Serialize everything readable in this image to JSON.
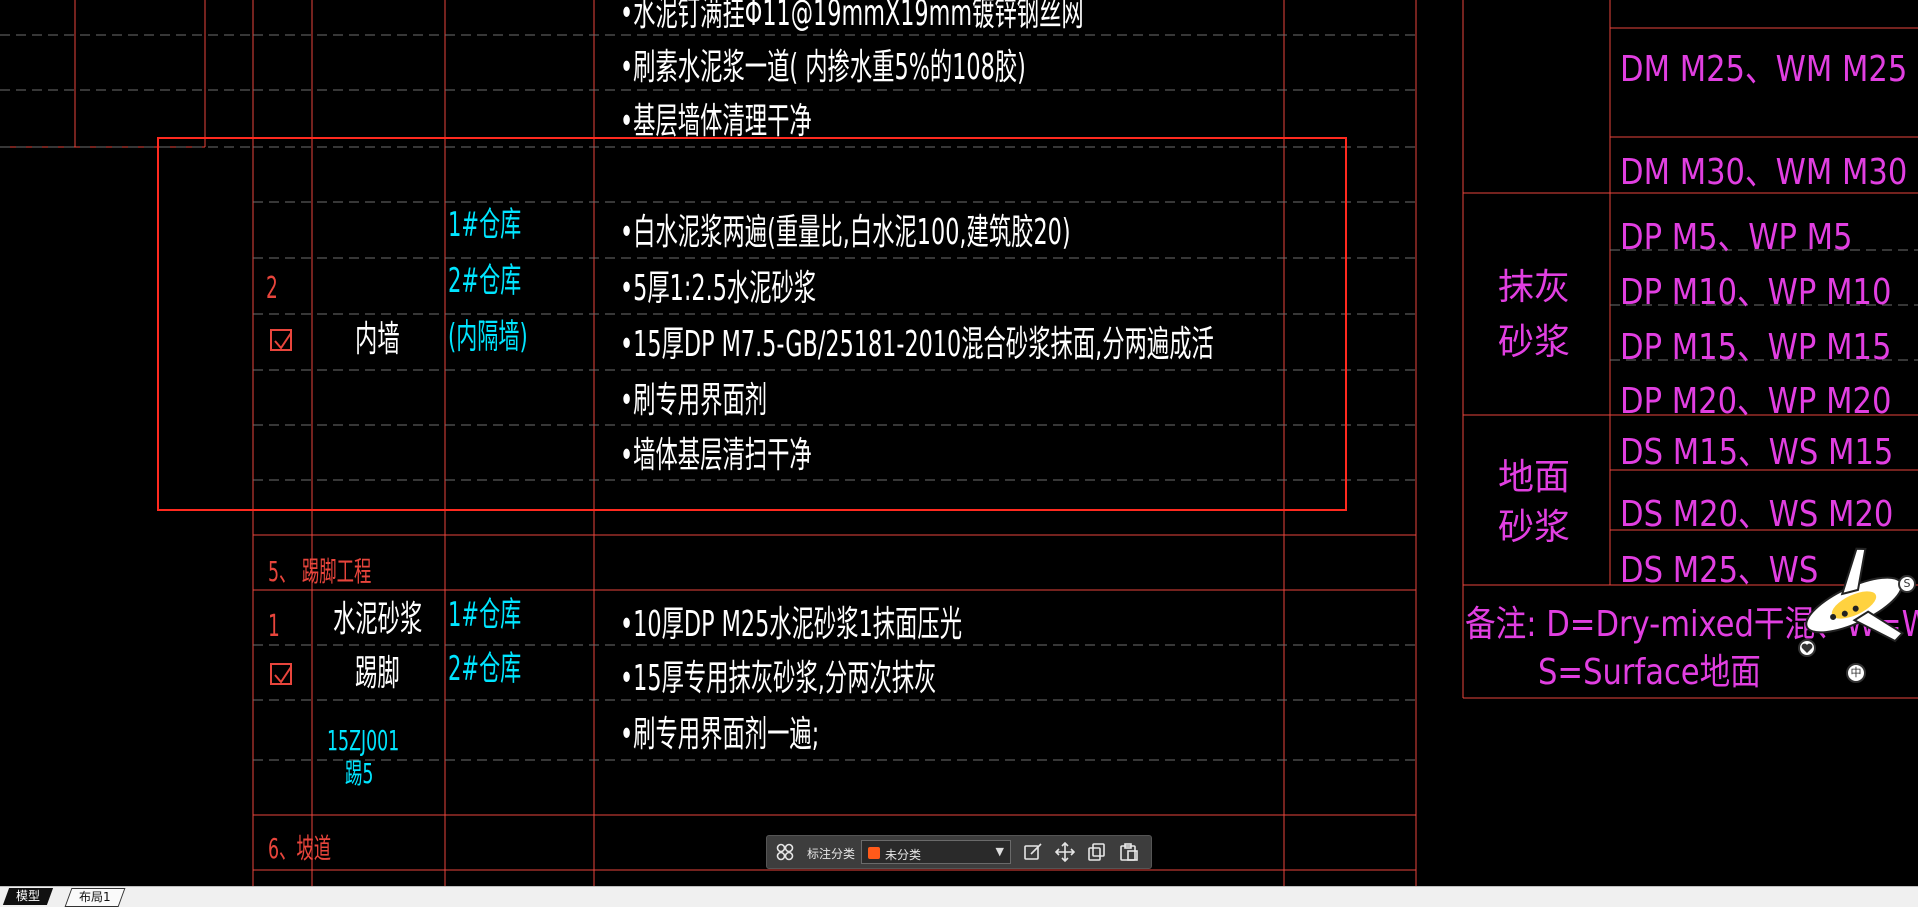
{
  "colors": {
    "background": "#000000",
    "grid_line": "#e8453c",
    "dashed_line": "#6e6e6e",
    "white_text": "#ffffff",
    "cyan_text": "#00e5ff",
    "magenta_text": "#e13fe1",
    "selection_box": "#ff2a1f",
    "toolbar_bg": "#3d3d3d",
    "swatch": "#ff5a1a"
  },
  "drawing": {
    "top_rows": [
      "•水泥钉满挂Φ11@19mmX19mm镀锌钢丝网",
      "•刷素水泥浆一道( 内掺水重5%的108胶)",
      "•基层墙体清理干净"
    ],
    "inner_wall": {
      "row_no": "2",
      "name": "内墙",
      "locations": [
        "1#仓库",
        "2#仓库",
        "(内隔墙)"
      ],
      "steps": [
        "•白水泥浆两遍(重量比,白水泥100,建筑胶20)",
        "•5厚1:2.5水泥砂浆",
        "•15厚DP  M7.5-GB/25181-2010混合砂浆抹面,分两遍成活",
        "•刷专用界面剂",
        "•墙体基层清扫干净"
      ]
    },
    "section5": {
      "heading": "5、 踢脚工程",
      "row_no": "1",
      "name_line1": "水泥砂浆",
      "name_line2": "踢脚",
      "locations": [
        "1#仓库",
        "2#仓库"
      ],
      "ref_line1": "15ZJ001",
      "ref_line2": "踢5",
      "steps": [
        "•10厚DP  M25水泥砂浆1抹面压光",
        "•15厚专用抹灰砂浆,分两次抹灰",
        "•刷专用界面剂一遍;"
      ]
    },
    "section6": {
      "heading": "6、坡道"
    },
    "mortar_table": {
      "masonry_rows": [
        "DM M25、WM M25",
        "DM M30、WM M30"
      ],
      "plaster_label_1": "抹灰",
      "plaster_label_2": "砂浆",
      "plaster_rows": [
        "DP M5、WP M5",
        "DP M10、WP M10",
        "DP M15、WP M15",
        "DP M20、WP M20"
      ],
      "floor_label_1": "地面",
      "floor_label_2": "砂浆",
      "floor_rows": [
        "DS M15、WS M15",
        "DS M20、WS M20",
        "DS M25、WS"
      ],
      "note_line1": "备注: D=Dry-mixed干混、W=W",
      "note_line2": "S=Surface地面"
    }
  },
  "toolbar": {
    "label": "标注分类",
    "selected": "未分类",
    "icons": [
      "grid-icon",
      "edit-icon",
      "move-icon",
      "copy-icon",
      "paste-icon"
    ]
  },
  "tabs": {
    "model": "模型",
    "layout": "布局1"
  },
  "mascot": {
    "icons": [
      "s-badge-icon",
      "heart-badge-icon",
      "zh-badge-icon"
    ],
    "badge_s": "S",
    "badge_zh": "中"
  }
}
